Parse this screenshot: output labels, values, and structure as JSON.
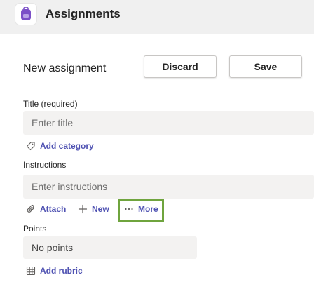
{
  "header": {
    "app_title": "Assignments",
    "app_icon": "backpack-icon",
    "accent": "#7b4fc7"
  },
  "form": {
    "heading": "New assignment",
    "discard_label": "Discard",
    "save_label": "Save",
    "title_label": "Title (required)",
    "title_placeholder": "Enter title",
    "add_category_label": "Add category",
    "instructions_label": "Instructions",
    "instructions_placeholder": "Enter instructions",
    "attach_label": "Attach",
    "new_label": "New",
    "more_label": "More",
    "points_label": "Points",
    "points_value": "No points",
    "add_rubric_label": "Add rubric"
  },
  "colors": {
    "link": "#4f52b2",
    "highlight": "#6fa43e",
    "field_bg": "#f3f2f1"
  }
}
